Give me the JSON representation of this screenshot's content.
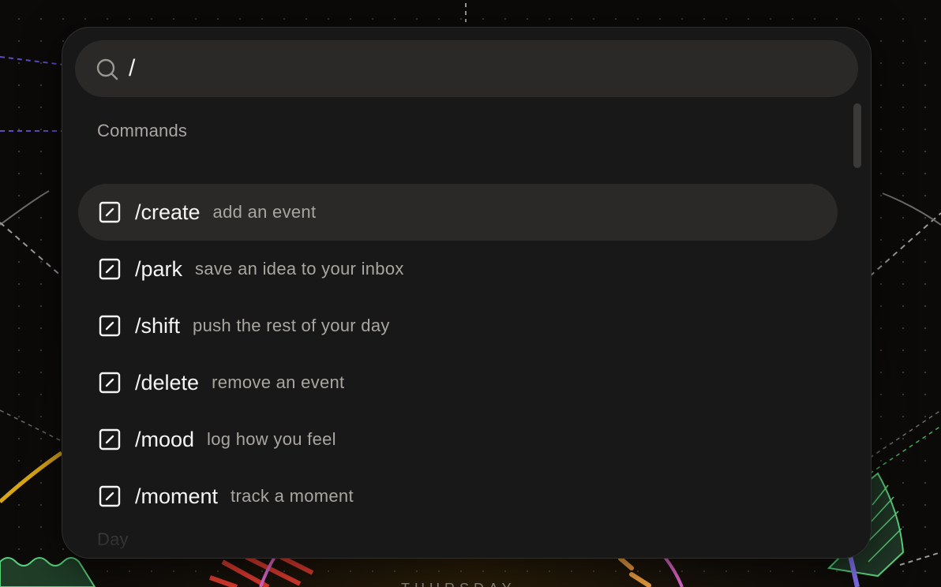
{
  "search": {
    "value": "/",
    "placeholder": ""
  },
  "sections": {
    "commands_label": "Commands",
    "day_label": "Day"
  },
  "commands": [
    {
      "name": "/create",
      "desc": "add an event",
      "active": true
    },
    {
      "name": "/park",
      "desc": "save an idea to your inbox",
      "active": false
    },
    {
      "name": "/shift",
      "desc": "push the rest of your day",
      "active": false
    },
    {
      "name": "/delete",
      "desc": "remove an event",
      "active": false
    },
    {
      "name": "/mood",
      "desc": "log how you feel",
      "active": false
    },
    {
      "name": "/moment",
      "desc": "track a moment",
      "active": false
    }
  ],
  "background": {
    "weekday_label": "THURSDAY"
  },
  "icons": {
    "search": "search-icon",
    "command": "pencil-square-icon"
  },
  "colors": {
    "palette_bg": "#181818",
    "search_bg": "#2a2928",
    "active_row_bg": "#2a2927",
    "text_primary": "#f4f4f4",
    "text_secondary": "#a9a6a1"
  }
}
